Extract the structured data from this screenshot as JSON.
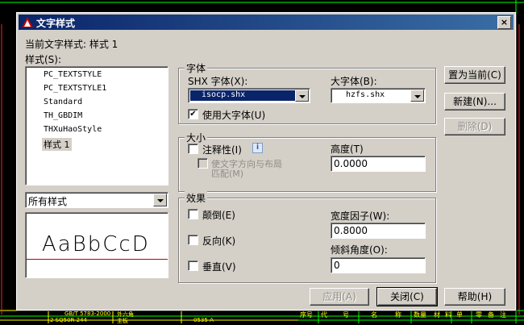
{
  "dialog": {
    "title": "文字样式",
    "current_style_label": "当前文字样式: 样式 1",
    "styles_label": "样式(S):",
    "styles": [
      "PC_TEXTSTYLE",
      "PC_TEXTSTYLE1",
      "Standard",
      "TH_GBDIM",
      "THXuHaoStyle",
      "样式 1"
    ],
    "selected_style_index": 5,
    "filter_value": "所有样式",
    "preview_text": "AaBbCcD",
    "font_group": {
      "title": "字体",
      "shx_label": "SHX 字体(X):",
      "shx_value": "isocp.shx",
      "bigfont_label": "大字体(B):",
      "bigfont_value": "hzfs.shx",
      "use_bigfont_label": "使用大字体(U)",
      "use_bigfont_checked": true
    },
    "size_group": {
      "title": "大小",
      "annotative_label": "注释性(I)",
      "info_glyph": "i",
      "match_orientation_line1": "使文字方向与布局",
      "match_orientation_line2": "匹配(M)",
      "height_label": "高度(T)",
      "height_value": "0.0000"
    },
    "effects_group": {
      "title": "效果",
      "upside_down_label": "颠倒(E)",
      "backwards_label": "反向(K)",
      "vertical_label": "垂直(V)",
      "width_factor_label": "宽度因子(W):",
      "width_factor_value": "0.8000",
      "oblique_label": "倾斜角度(O):",
      "oblique_value": "0"
    },
    "buttons": {
      "set_current": "置为当前(C)",
      "new": "新建(N)...",
      "delete": "删除(D)",
      "apply": "应用(A)",
      "close": "关闭(C)",
      "help": "帮助(H)"
    },
    "close_glyph": "×"
  },
  "background": {
    "table_cells": [
      "序号",
      "代",
      "号",
      "名",
      "称",
      "数量",
      "材",
      "料",
      "单",
      "零",
      "备",
      "注"
    ],
    "row_text": [
      "GB/T 5783-2000",
      "外六角",
      "2 SQ50R-244",
      "主板",
      "0535-A"
    ]
  },
  "colors": {
    "titlebar_start": "#0a246a",
    "dialog_face": "#d4d0c8",
    "cad_yellow": "#ffff00",
    "cad_green": "#00ff00"
  }
}
